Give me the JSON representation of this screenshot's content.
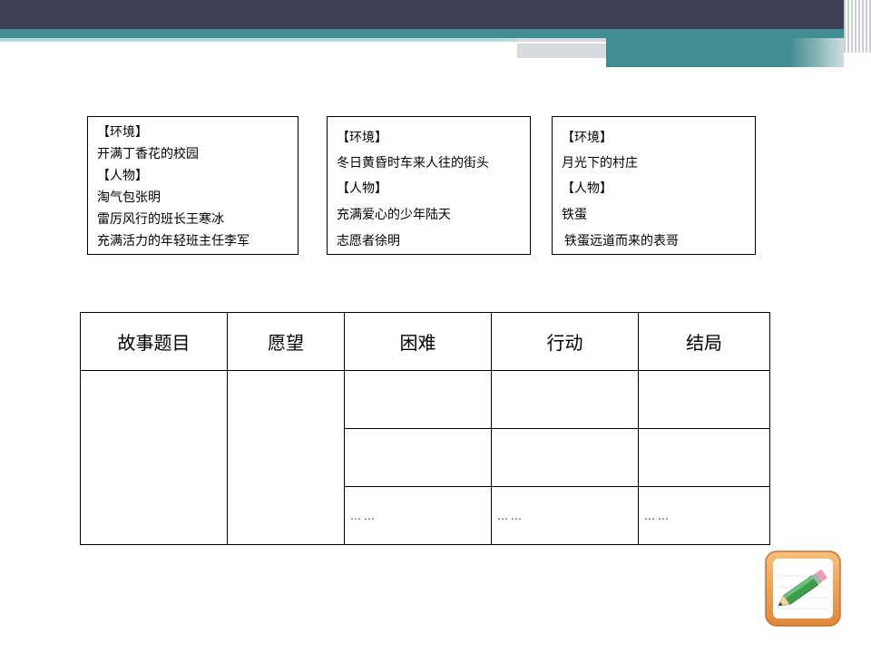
{
  "boxes": [
    {
      "lines": [
        "【环境】",
        "开满丁香花的校园",
        "【人物】",
        "淘气包张明",
        "雷厉风行的班长王寒冰",
        "充满活力的年轻班主任李军"
      ]
    },
    {
      "lines": [
        "【环境】",
        "冬日黄昏时车来人往的街头",
        "【人物】",
        "充满爱心的少年陆天",
        "志愿者徐明"
      ]
    },
    {
      "lines": [
        "【环境】",
        "月光下的村庄",
        "【人物】",
        "铁蛋",
        "铁蛋远道而来的表哥"
      ]
    }
  ],
  "table": {
    "headers": [
      "故事题目",
      "愿望",
      "困难",
      "行动",
      "结局"
    ],
    "ellipsis": "……"
  },
  "colors": {
    "header_dark": "#3f4254",
    "header_teal": "#3f8c91",
    "icon_orange": "#f0a04a",
    "icon_green": "#3aa04a"
  },
  "icons": {
    "corner": "pencil-notebook-icon"
  }
}
